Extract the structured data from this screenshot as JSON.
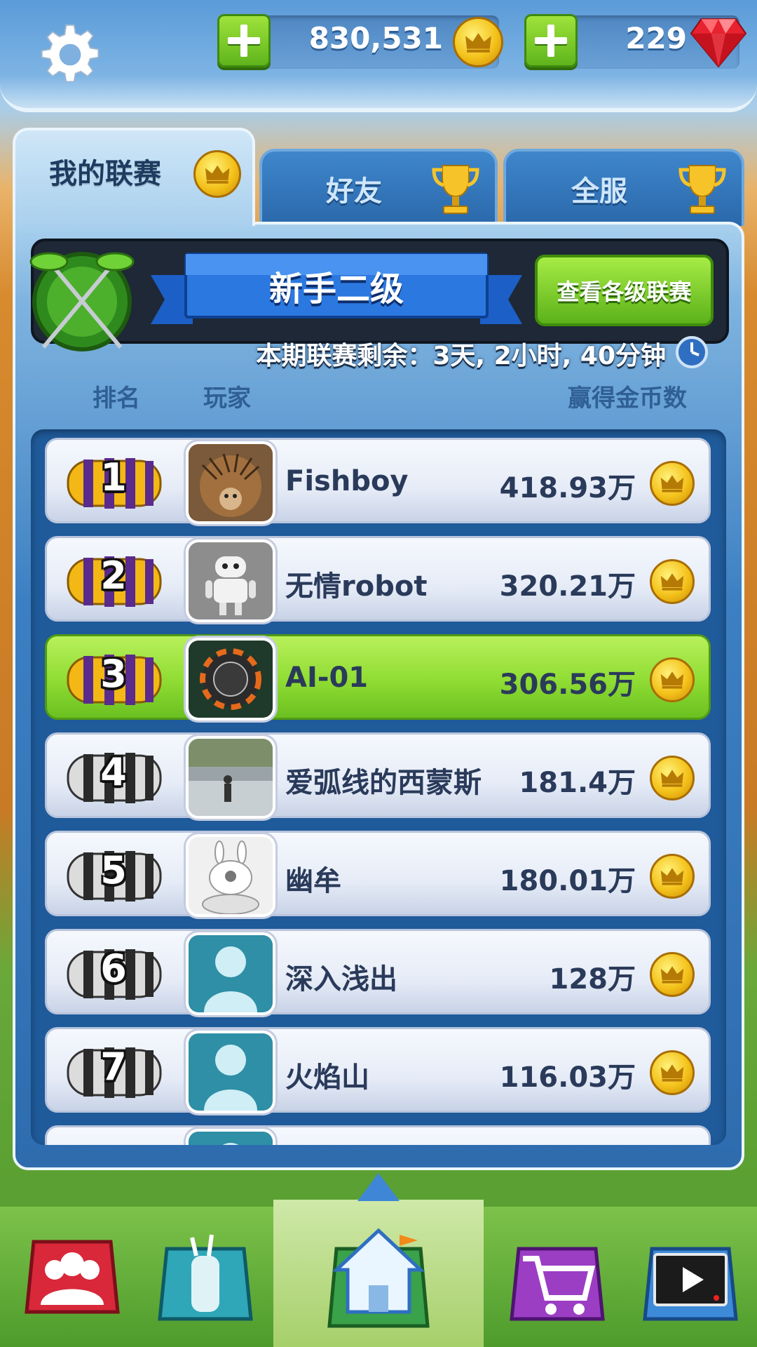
{
  "topbar": {
    "coins": "830,531",
    "gems": "229",
    "icons": {
      "settings": "gear-icon",
      "coin": "crown-coin-icon",
      "gem": "red-gem-icon",
      "add": "plus-icon"
    }
  },
  "tabs": [
    {
      "label": "我的联赛",
      "active": true,
      "icon": "crown-coin-icon"
    },
    {
      "label": "好友",
      "active": false,
      "icon": "trophy-icon"
    },
    {
      "label": "全服",
      "active": false,
      "icon": "trophy-icon"
    }
  ],
  "league": {
    "name": "新手二级",
    "view_button": "查看各级联赛",
    "time_remaining": "本期联赛剩余：3天, 2小时, 40分钟"
  },
  "columns": {
    "rank": "排名",
    "player": "玩家",
    "coins": "赢得金币数"
  },
  "leaderboard": [
    {
      "rank": "1",
      "name": "Fishboy",
      "score": "418.93万",
      "badge": "gold",
      "me": false,
      "avatar": "hedgehog"
    },
    {
      "rank": "2",
      "name": "无情robot",
      "score": "320.21万",
      "badge": "gold",
      "me": false,
      "avatar": "robot"
    },
    {
      "rank": "3",
      "name": "AI-01",
      "score": "306.56万",
      "badge": "gold",
      "me": true,
      "avatar": "chip"
    },
    {
      "rank": "4",
      "name": "爱弧线的西蒙斯",
      "score": "181.4万",
      "badge": "silver",
      "me": false,
      "avatar": "photo"
    },
    {
      "rank": "5",
      "name": "幽牟",
      "score": "180.01万",
      "badge": "silver",
      "me": false,
      "avatar": "rabbit"
    },
    {
      "rank": "6",
      "name": "深入浅出",
      "score": "128万",
      "badge": "silver",
      "me": false,
      "avatar": "default"
    },
    {
      "rank": "7",
      "name": "火焰山",
      "score": "116.03万",
      "badge": "silver",
      "me": false,
      "avatar": "default"
    }
  ],
  "colors": {
    "accent_green": "#8fdc33",
    "panel_blue": "#2e6cae",
    "text_dark": "#2a3a5a"
  },
  "nav": [
    "team-icon",
    "golf-bag-icon",
    "home-icon",
    "shop-cart-icon",
    "video-icon"
  ]
}
